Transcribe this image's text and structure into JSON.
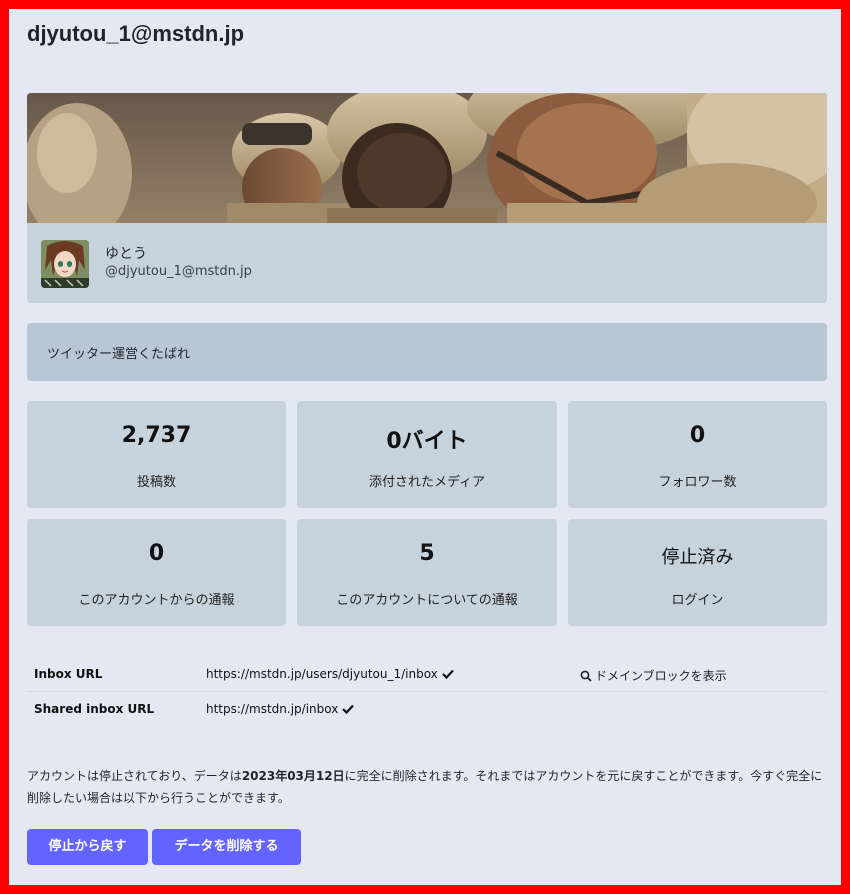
{
  "page": {
    "title": "djyutou_1@mstdn.jp"
  },
  "profile": {
    "display_name": "ゆとう",
    "handle": "@djyutou_1@mstdn.jp",
    "bio": "ツイッター運営くたばれ"
  },
  "stats": [
    {
      "value": "2,737",
      "label": "投稿数"
    },
    {
      "value": "0バイト",
      "label": "添付されたメディア"
    },
    {
      "value": "0",
      "label": "フォロワー数"
    },
    {
      "value": "0",
      "label": "このアカウントからの通報"
    },
    {
      "value": "5",
      "label": "このアカウントについての通報"
    },
    {
      "value": "停止済み",
      "label": "ログイン"
    }
  ],
  "info": {
    "inbox_key": "Inbox URL",
    "inbox_value": "https://mstdn.jp/users/djyutou_1/inbox",
    "shared_key": "Shared inbox URL",
    "shared_value": "https://mstdn.jp/inbox",
    "domain_block_link": "ドメインブロックを表示"
  },
  "notice": {
    "before": "アカウントは停止されており、データは",
    "date": "2023年03月12日",
    "after": "に完全に削除されます。それまではアカウントを元に戻すことができます。今すぐ完全に削除したい場合は以下から行うことができます。"
  },
  "actions": {
    "restore_label": "停止から戻す",
    "delete_label": "データを削除する"
  },
  "colors": {
    "accent": "#6364ff",
    "frame_border": "#ff0000",
    "background": "#e3e8f2",
    "card": "#c6d3dd",
    "bio_box": "#b9c6d3"
  },
  "icons": {
    "verified": "check-icon",
    "search": "search-icon"
  }
}
